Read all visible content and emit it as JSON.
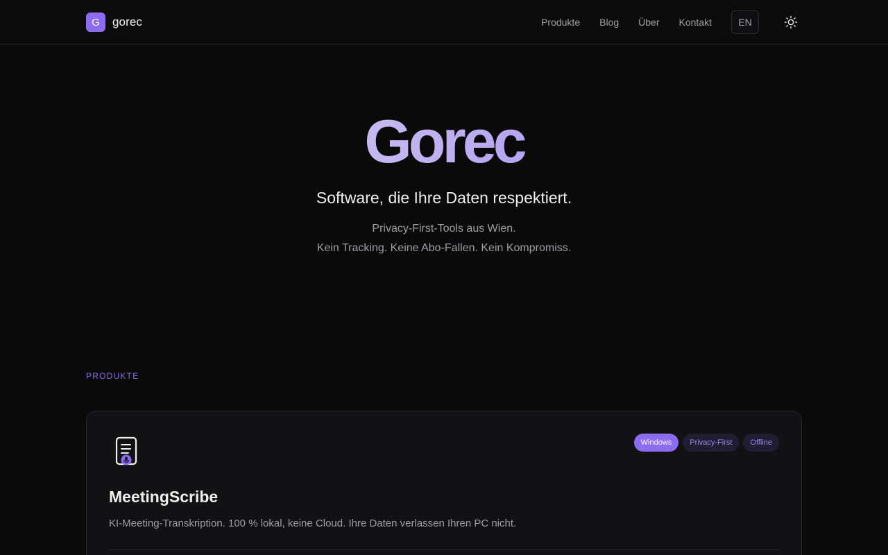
{
  "brand": {
    "badge": "G",
    "name": "gorec"
  },
  "nav": {
    "items": [
      {
        "label": "Produkte"
      },
      {
        "label": "Blog"
      },
      {
        "label": "Über"
      },
      {
        "label": "Kontakt"
      }
    ],
    "language": "EN",
    "theme_icon": "sun-icon"
  },
  "hero": {
    "title": "Gorec",
    "subtitle": "Software, die Ihre Daten respektiert.",
    "line1": "Privacy-First-Tools aus Wien.",
    "line2": "Kein Tracking. Keine Abo-Fallen. Kein Kompromiss."
  },
  "products": {
    "section_label": "PRODUKTE",
    "items": [
      {
        "icon": "document-microphone-icon",
        "name": "MeetingScribe",
        "description": "KI-Meeting-Transkription. 100 % lokal, keine Cloud. Ihre Daten verlassen Ihren PC nicht.",
        "tags": [
          "Windows",
          "Privacy-First",
          "Offline"
        ]
      }
    ]
  },
  "colors": {
    "accent": "#8b6cf0",
    "background": "#0a0a0b",
    "card": "#121215"
  }
}
